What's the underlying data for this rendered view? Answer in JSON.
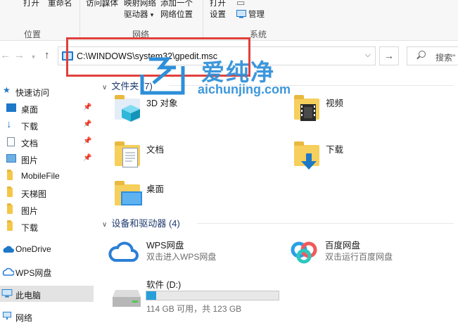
{
  "ribbon": {
    "top_items": [
      "打开",
      "重命名",
      "访问媒体",
      "映射网络",
      "添加一个",
      "打开"
    ],
    "map_drive_label": "驱动器",
    "network_location_label": "网络位置",
    "settings_label": "设置",
    "manage_label": "管理",
    "groups": [
      "位置",
      "网络",
      "系统"
    ]
  },
  "address": {
    "path": "C:\\WINDOWS\\system32\\gpedit.msc",
    "search_placeholder": "搜索\""
  },
  "sidebar": {
    "items": [
      {
        "label": "快速访问",
        "icon": "star-icon",
        "pinned": false
      },
      {
        "label": "桌面",
        "icon": "desktop-icon",
        "pinned": true
      },
      {
        "label": "下载",
        "icon": "download-icon",
        "pinned": true
      },
      {
        "label": "文档",
        "icon": "document-icon",
        "pinned": true
      },
      {
        "label": "图片",
        "icon": "pictures-icon",
        "pinned": true
      },
      {
        "label": "MobileFile",
        "icon": "folder-icon",
        "pinned": false
      },
      {
        "label": "天梯图",
        "icon": "folder-icon",
        "pinned": false
      },
      {
        "label": "图片",
        "icon": "folder-icon",
        "pinned": false
      },
      {
        "label": "下载",
        "icon": "folder-icon",
        "pinned": false
      },
      {
        "label": "OneDrive",
        "icon": "cloud-icon",
        "pinned": false
      },
      {
        "label": "WPS网盘",
        "icon": "wps-cloud-icon",
        "pinned": false
      },
      {
        "label": "此电脑",
        "icon": "computer-icon",
        "pinned": false,
        "selected": true
      },
      {
        "label": "网络",
        "icon": "network-icon",
        "pinned": false
      }
    ]
  },
  "main": {
    "folders_header": "文件夹 (7)",
    "folders": [
      {
        "label": "3D 对象",
        "icon": "3d-objects-icon"
      },
      {
        "label": "视频",
        "icon": "videos-icon"
      },
      {
        "label": "文档",
        "icon": "documents-folder-icon"
      },
      {
        "label": "下载",
        "icon": "downloads-folder-icon"
      },
      {
        "label": "桌面",
        "icon": "desktop-folder-icon"
      }
    ],
    "devices_header": "设备和驱动器 (4)",
    "devices": [
      {
        "label": "WPS网盘",
        "sub": "双击进入WPS网盘",
        "icon": "wps-cloud-icon"
      },
      {
        "label": "百度网盘",
        "sub": "双击运行百度网盘",
        "icon": "baidu-netdisk-icon"
      }
    ],
    "drive": {
      "label": "软件 (D:)",
      "usage_text": "114 GB 可用，共 123 GB",
      "used_fraction": 0.073,
      "icon": "hard-drive-icon"
    }
  },
  "watermark": {
    "title": "爱纯净",
    "url": "aichunjing.com"
  },
  "colors": {
    "accent": "#1e78c8",
    "highlight": "#e0403c",
    "watermark": "#2d8fd9",
    "drive_fill": "#27a0da"
  }
}
